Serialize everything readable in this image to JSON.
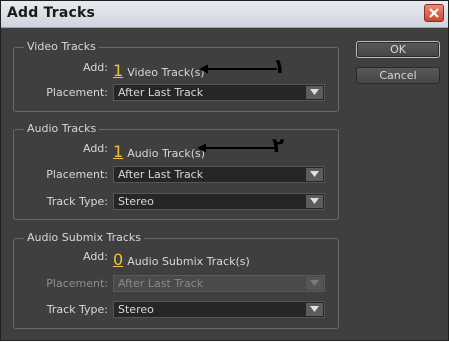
{
  "dialog": {
    "title": "Add Tracks"
  },
  "buttons": {
    "ok": "OK",
    "cancel": "Cancel"
  },
  "video": {
    "section_title": "Video Tracks",
    "add_label": "Add:",
    "count": "1",
    "add_suffix": "Video Track(s)",
    "placement_label": "Placement:",
    "placement_value": "After Last Track"
  },
  "audio": {
    "section_title": "Audio Tracks",
    "add_label": "Add:",
    "count": "1",
    "add_suffix": "Audio Track(s)",
    "placement_label": "Placement:",
    "placement_value": "After Last Track",
    "track_type_label": "Track Type:",
    "track_type_value": "Stereo"
  },
  "submix": {
    "section_title": "Audio Submix Tracks",
    "add_label": "Add:",
    "count": "0",
    "add_suffix": "Audio Submix Track(s)",
    "placement_label": "Placement:",
    "placement_value": "After Last Track",
    "track_type_label": "Track Type:",
    "track_type_value": "Stereo"
  },
  "annotations": {
    "first": "١",
    "second": "٢"
  }
}
